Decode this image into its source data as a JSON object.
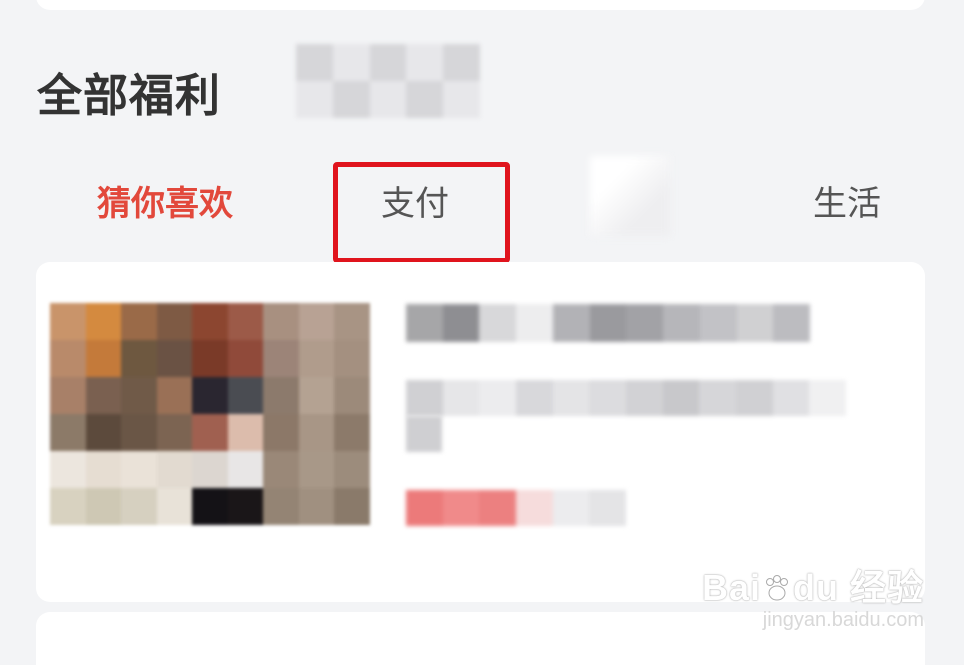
{
  "section": {
    "title": "全部福利"
  },
  "tabs": [
    {
      "label": "猜你喜欢",
      "active": true
    },
    {
      "label": "支付",
      "active": false
    },
    {
      "label": "",
      "active": false
    },
    {
      "label": "生活",
      "active": false
    }
  ],
  "highlight_color": "#e0141d",
  "active_tab_color": "#e2483b",
  "watermark": {
    "brand_prefix": "Bai",
    "brand_suffix": "du",
    "brand_cn": "经验",
    "url": "jingyan.baidu.com"
  }
}
